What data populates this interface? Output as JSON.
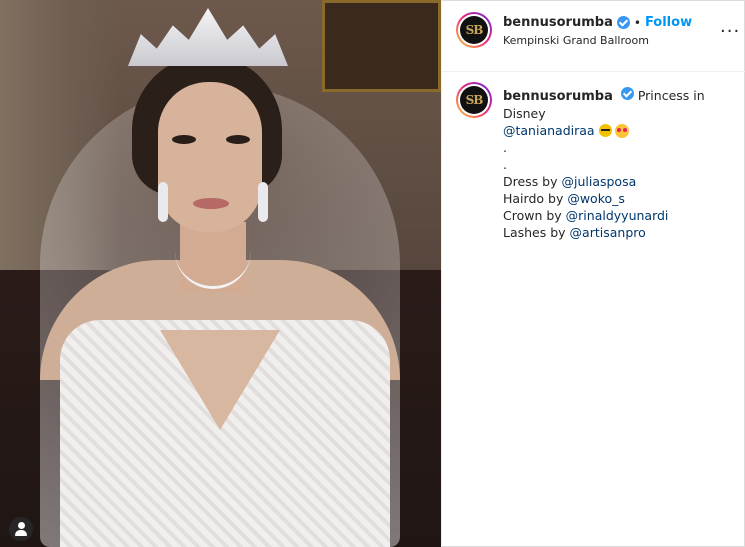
{
  "post": {
    "username": "bennusorumba",
    "follow_label": "Follow",
    "separator": "•",
    "location": "Kempinski Grand Ballroom",
    "more_label": "...",
    "avatar_initials": "SB"
  },
  "caption": {
    "username": "bennusorumba",
    "text_intro": "Princess in Disney",
    "mention_main": "@tanianadiraa",
    "dot1": ".",
    "dot2": ".",
    "credits": [
      {
        "label": "Dress by ",
        "mention": "@juliasposa"
      },
      {
        "label": "Hairdo by ",
        "mention": "@woko_s"
      },
      {
        "label": "Crown by ",
        "mention": "@rinaldyyunardi"
      },
      {
        "label": "Lashes by ",
        "mention": "@artisanpro"
      }
    ]
  },
  "colors": {
    "follow": "#0095f6",
    "verified": "#3897f0",
    "mention": "#00376b"
  }
}
